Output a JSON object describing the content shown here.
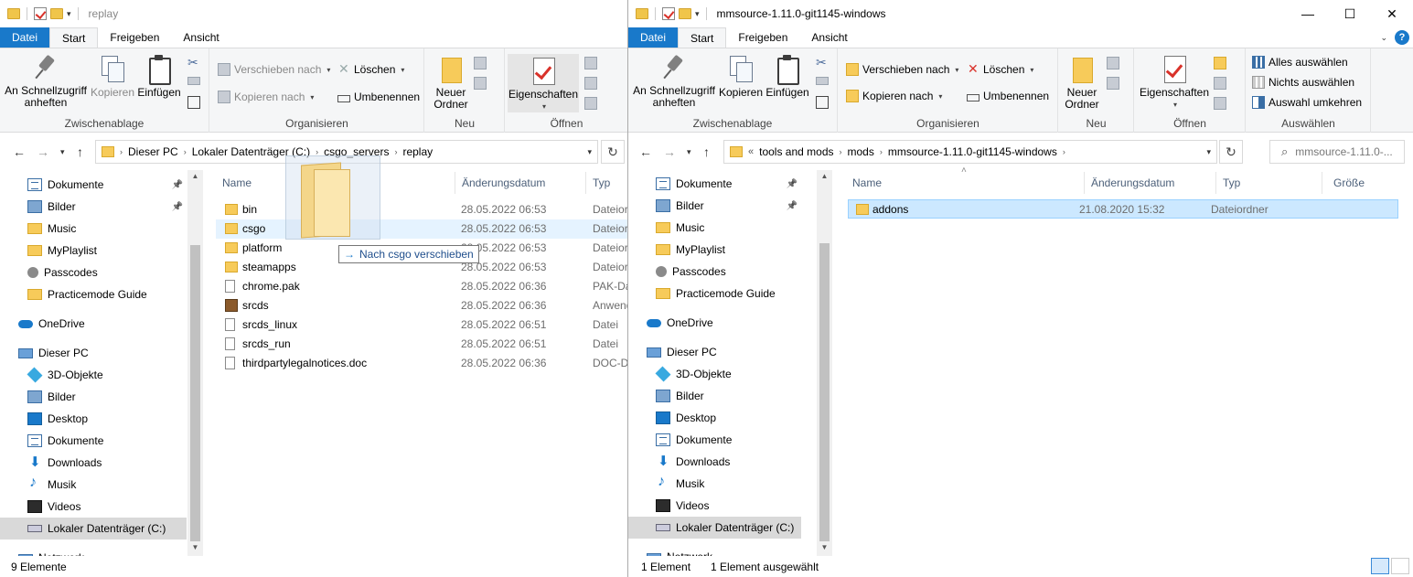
{
  "left": {
    "title": "replay",
    "tabs": [
      "Datei",
      "Start",
      "Freigeben",
      "Ansicht"
    ],
    "ribbon": {
      "pin": "An Schnellzugriff anheften",
      "copy": "Kopieren",
      "paste": "Einfügen",
      "clipboard_group": "Zwischenablage",
      "move_to": "Verschieben nach",
      "copy_to": "Kopieren nach",
      "delete": "Löschen",
      "rename": "Umbenennen",
      "organize_group": "Organisieren",
      "new_folder": "Neuer Ordner",
      "new_group": "Neu",
      "properties": "Eigenschaften",
      "open_group": "Öffnen"
    },
    "breadcrumb": [
      "Dieser PC",
      "Lokaler Datenträger (C:)",
      "csgo_servers",
      "replay"
    ],
    "nav": [
      {
        "label": "Dokumente",
        "icon": "doc",
        "pinned": true
      },
      {
        "label": "Bilder",
        "icon": "pics",
        "pinned": true
      },
      {
        "label": "Music",
        "icon": "folder"
      },
      {
        "label": "MyPlaylist",
        "icon": "folder"
      },
      {
        "label": "Passcodes",
        "icon": "key"
      },
      {
        "label": "Practicemode Guide",
        "icon": "folder"
      },
      {
        "label": "OneDrive",
        "icon": "cloud"
      },
      {
        "label": "Dieser PC",
        "icon": "pc"
      },
      {
        "label": "3D-Objekte",
        "icon": "cube"
      },
      {
        "label": "Bilder",
        "icon": "pics"
      },
      {
        "label": "Desktop",
        "icon": "desk"
      },
      {
        "label": "Dokumente",
        "icon": "doc"
      },
      {
        "label": "Downloads",
        "icon": "down"
      },
      {
        "label": "Musik",
        "icon": "music"
      },
      {
        "label": "Videos",
        "icon": "video"
      },
      {
        "label": "Lokaler Datenträger (C:)",
        "icon": "drive"
      },
      {
        "label": "Netzwerk",
        "icon": "net"
      }
    ],
    "columns": {
      "name": "Name",
      "date": "Änderungsdatum",
      "type": "Typ"
    },
    "files": [
      {
        "name": "bin",
        "date": "28.05.2022 06:53",
        "type": "Dateiordner",
        "icon": "folder"
      },
      {
        "name": "csgo",
        "date": "28.05.2022 06:53",
        "type": "Dateiordner",
        "icon": "folder"
      },
      {
        "name": "platform",
        "date": "28.05.2022 06:53",
        "type": "Dateiordner",
        "icon": "folder"
      },
      {
        "name": "steamapps",
        "date": "28.05.2022 06:53",
        "type": "Dateiordner",
        "icon": "folder"
      },
      {
        "name": "chrome.pak",
        "date": "28.05.2022 06:36",
        "type": "PAK-Datei",
        "icon": "file"
      },
      {
        "name": "srcds",
        "date": "28.05.2022 06:36",
        "type": "Anwendung",
        "icon": "app"
      },
      {
        "name": "srcds_linux",
        "date": "28.05.2022 06:51",
        "type": "Datei",
        "icon": "file"
      },
      {
        "name": "srcds_run",
        "date": "28.05.2022 06:51",
        "type": "Datei",
        "icon": "file"
      },
      {
        "name": "thirdpartylegalnotices.doc",
        "date": "28.05.2022 06:36",
        "type": "DOC-Datei",
        "icon": "file"
      }
    ],
    "drop_tip": "Nach csgo verschieben",
    "status": "9 Elemente"
  },
  "right": {
    "title": "mmsource-1.11.0-git1145-windows",
    "tabs": [
      "Datei",
      "Start",
      "Freigeben",
      "Ansicht"
    ],
    "ribbon": {
      "pin": "An Schnellzugriff anheften",
      "copy": "Kopieren",
      "paste": "Einfügen",
      "clipboard_group": "Zwischenablage",
      "move_to": "Verschieben nach",
      "copy_to": "Kopieren nach",
      "delete": "Löschen",
      "rename": "Umbenennen",
      "organize_group": "Organisieren",
      "new_folder": "Neuer Ordner",
      "new_group": "Neu",
      "properties": "Eigenschaften",
      "open_group": "Öffnen",
      "select_all": "Alles auswählen",
      "select_none": "Nichts auswählen",
      "invert_selection": "Auswahl umkehren",
      "select_group": "Auswählen"
    },
    "breadcrumb": [
      "tools and mods",
      "mods",
      "mmsource-1.11.0-git1145-windows"
    ],
    "search_placeholder": "mmsource-1.11.0-...",
    "nav": [
      {
        "label": "Dokumente",
        "icon": "doc",
        "pinned": true
      },
      {
        "label": "Bilder",
        "icon": "pics",
        "pinned": true
      },
      {
        "label": "Music",
        "icon": "folder"
      },
      {
        "label": "MyPlaylist",
        "icon": "folder"
      },
      {
        "label": "Passcodes",
        "icon": "key"
      },
      {
        "label": "Practicemode Guide",
        "icon": "folder"
      },
      {
        "label": "OneDrive",
        "icon": "cloud"
      },
      {
        "label": "Dieser PC",
        "icon": "pc"
      },
      {
        "label": "3D-Objekte",
        "icon": "cube"
      },
      {
        "label": "Bilder",
        "icon": "pics"
      },
      {
        "label": "Desktop",
        "icon": "desk"
      },
      {
        "label": "Dokumente",
        "icon": "doc"
      },
      {
        "label": "Downloads",
        "icon": "down"
      },
      {
        "label": "Musik",
        "icon": "music"
      },
      {
        "label": "Videos",
        "icon": "video"
      },
      {
        "label": "Lokaler Datenträger (C:)",
        "icon": "drive"
      },
      {
        "label": "Netzwerk",
        "icon": "net"
      }
    ],
    "columns": {
      "name": "Name",
      "date": "Änderungsdatum",
      "type": "Typ",
      "size": "Größe"
    },
    "files": [
      {
        "name": "addons",
        "date": "21.08.2020 15:32",
        "type": "Dateiordner",
        "icon": "folder"
      }
    ],
    "status_count": "1 Element",
    "status_selected": "1 Element ausgewählt"
  }
}
